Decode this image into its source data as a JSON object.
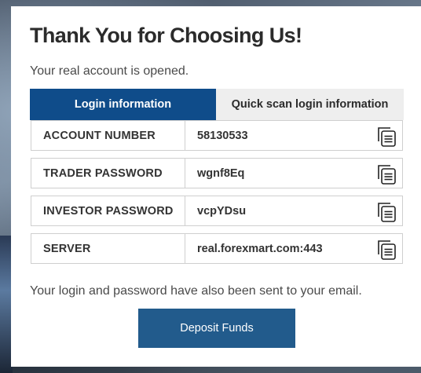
{
  "modal": {
    "title": "Thank You for Choosing Us!",
    "subtitle": "Your real account is opened.",
    "tabs": [
      {
        "label": "Login information",
        "active": true
      },
      {
        "label": "Quick scan login information",
        "active": false
      }
    ],
    "fields": [
      {
        "label": "ACCOUNT NUMBER",
        "value": "58130533",
        "icon": "copy-icon"
      },
      {
        "label": "TRADER PASSWORD",
        "value": "wgnf8Eq",
        "icon": "copy-icon"
      },
      {
        "label": "INVESTOR PASSWORD",
        "value": "vcpYDsu",
        "icon": "copy-icon"
      },
      {
        "label": "SERVER",
        "value": "real.forexmart.com:443",
        "icon": "copy-icon"
      }
    ],
    "note": "Your login and password have also been sent to your email.",
    "deposit_label": "Deposit Funds"
  },
  "colors": {
    "tab_active": "#0f4c8a",
    "tab_inactive": "#eeeeee",
    "button": "#225b8c"
  }
}
